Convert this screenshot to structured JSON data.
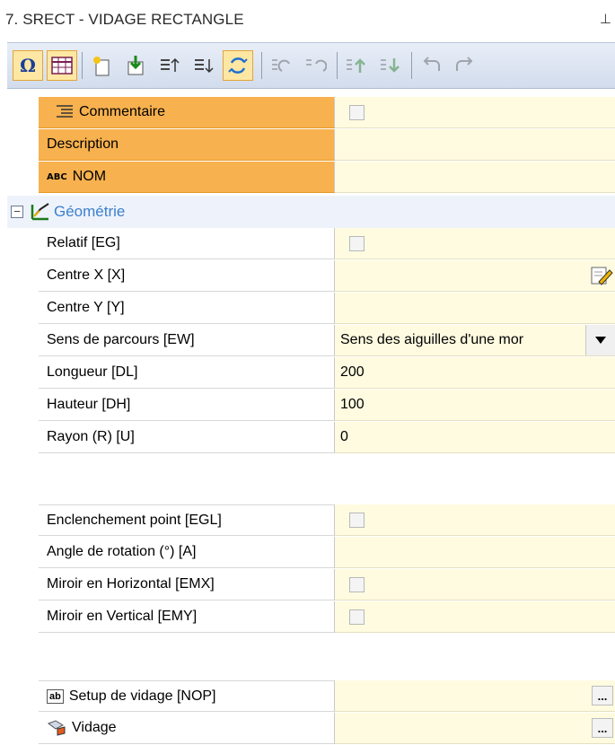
{
  "panel": {
    "title": "7. SRECT - VIDAGE RECTANGLE",
    "pin_glyph": "⊥"
  },
  "toolbar": {
    "buttons": [
      {
        "icon": "omega-icon",
        "glyph": "Ω",
        "active": true
      },
      {
        "icon": "grid-icon",
        "glyph": "▦",
        "active": true
      },
      {
        "icon": "new-icon",
        "glyph": "✳"
      },
      {
        "icon": "import-icon",
        "glyph": "⬇"
      },
      {
        "icon": "move-up-icon",
        "glyph": "⇡"
      },
      {
        "icon": "move-down-icon",
        "glyph": "⇣"
      },
      {
        "icon": "refresh-icon",
        "glyph": "⟳",
        "active": true
      },
      {
        "icon": "rotate-left-icon",
        "glyph": "↺"
      },
      {
        "icon": "rotate-right-icon",
        "glyph": "↻"
      },
      {
        "icon": "sort-up-icon",
        "glyph": "⇧"
      },
      {
        "icon": "sort-down-icon",
        "glyph": "⇩"
      },
      {
        "icon": "undo-icon",
        "glyph": "↶"
      },
      {
        "icon": "redo-icon",
        "glyph": "↷"
      }
    ]
  },
  "rows": {
    "commentaire": {
      "label": "Commentaire"
    },
    "description": {
      "label": "Description"
    },
    "nom": {
      "label": "NOM",
      "icon_text": "ABC"
    },
    "geometrie": {
      "label": "Géométrie"
    },
    "relatif": {
      "label": "Relatif [EG]"
    },
    "centre_x": {
      "label": "Centre X [X]"
    },
    "centre_y": {
      "label": "Centre Y [Y]"
    },
    "sens": {
      "label": "Sens de parcours [EW]",
      "value": "Sens des aiguilles d'une mor"
    },
    "longueur": {
      "label": "Longueur [DL]",
      "value": "200"
    },
    "hauteur": {
      "label": "Hauteur [DH]",
      "value": "100"
    },
    "rayon": {
      "label": "Rayon (R) [U]",
      "value": "0"
    },
    "enclenchement": {
      "label": "Enclenchement point [EGL]"
    },
    "angle": {
      "label": "Angle de rotation (°) [A]"
    },
    "miroir_h": {
      "label": "Miroir en Horizontal [EMX]"
    },
    "miroir_v": {
      "label": "Miroir en Vertical [EMY]"
    },
    "setup": {
      "label": "Setup de vidage [NOP]",
      "icon_text": "ab"
    },
    "vidage": {
      "label": "Vidage"
    }
  },
  "buttons": {
    "ellipsis": "..."
  }
}
